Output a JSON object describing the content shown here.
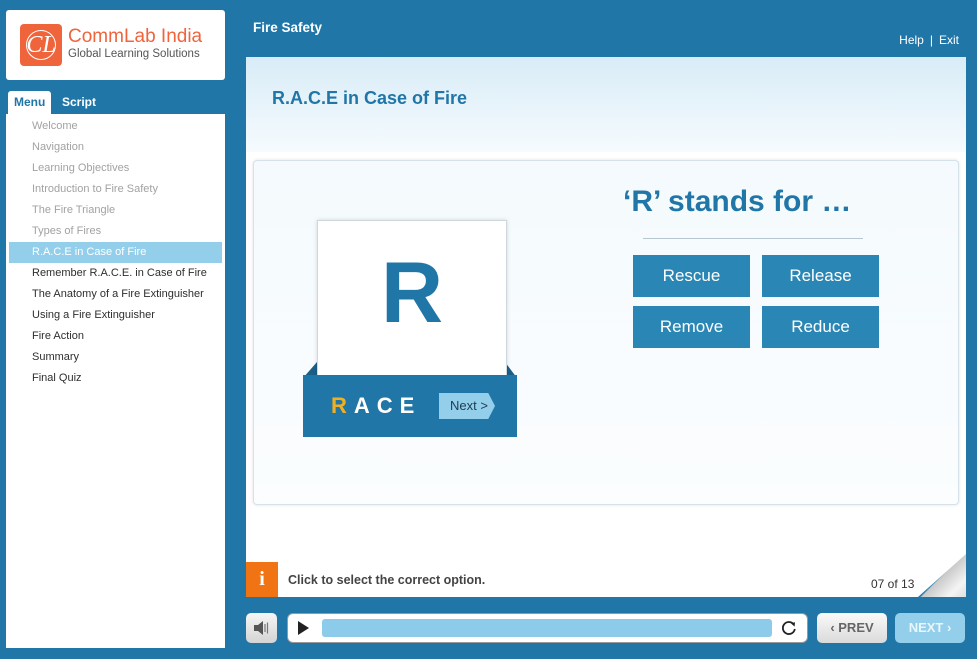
{
  "logo": {
    "mark": "CL",
    "name": "CommLab India",
    "tagline": "Global Learning Solutions"
  },
  "header": {
    "course_title": "Fire Safety",
    "help": "Help",
    "separator": "|",
    "exit": "Exit"
  },
  "sidebar": {
    "tabs": {
      "menu": "Menu",
      "script": "Script"
    },
    "items": [
      {
        "label": "Welcome",
        "state": "visited"
      },
      {
        "label": "Navigation",
        "state": "visited"
      },
      {
        "label": "Learning Objectives",
        "state": "visited"
      },
      {
        "label": "Introduction to Fire Safety",
        "state": "visited"
      },
      {
        "label": "The Fire Triangle",
        "state": "visited"
      },
      {
        "label": "Types of Fires",
        "state": "visited"
      },
      {
        "label": "R.A.C.E in Case of Fire",
        "state": "active"
      },
      {
        "label": "Remember R.A.C.E. in Case of Fire",
        "state": "normal"
      },
      {
        "label": "The Anatomy of a Fire Extinguisher",
        "state": "normal"
      },
      {
        "label": "Using a Fire Extinguisher",
        "state": "normal"
      },
      {
        "label": "Fire Action",
        "state": "normal"
      },
      {
        "label": "Summary",
        "state": "normal"
      },
      {
        "label": "Final Quiz",
        "state": "normal"
      }
    ]
  },
  "slide": {
    "title": "R.A.C.E in Case of Fire",
    "letter": "R",
    "race_first": "R",
    "race_rest": "ACE",
    "next_label": "Next >",
    "question": "‘R’ stands for …",
    "options": [
      "Rescue",
      "Release",
      "Remove",
      "Reduce"
    ]
  },
  "footer": {
    "info_icon": "i",
    "instruction": "Click to select the correct option.",
    "page_counter": "07 of 13"
  },
  "player": {
    "progress": 1.0,
    "prev_label": "PREV",
    "next_label": "NEXT"
  },
  "colors": {
    "primary": "#2176a8",
    "accent": "#f07414",
    "logo": "#f0643c",
    "highlight": "#93cfea",
    "race_highlight": "#f2b01e"
  }
}
